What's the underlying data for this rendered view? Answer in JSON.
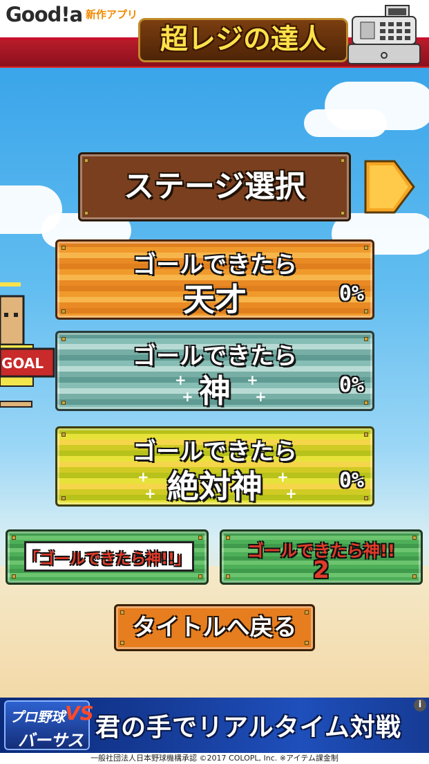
{
  "header": {
    "logo_text": "Good!a",
    "new_app_label": "新作アプリ",
    "app_title": "超レジの達人"
  },
  "menu": {
    "stage_select_label": "ステージ選択",
    "modes": [
      {
        "line1": "ゴールできたら",
        "line2": "天才",
        "progress": "0%"
      },
      {
        "line1": "ゴールできたら",
        "line2": "神",
        "progress": "0%"
      },
      {
        "line1": "ゴールできたら",
        "line2": "絶対神",
        "progress": "0%"
      }
    ],
    "game_links": [
      {
        "label": "「ゴールできたら神!!」"
      },
      {
        "label": "ゴールできたら神!!",
        "number": "2"
      }
    ],
    "back_label": "タイトルへ戻る"
  },
  "character": {
    "sign_text": "GOAL"
  },
  "ad": {
    "logo_line1": "プロ野球",
    "logo_vs": "VS",
    "logo_line2": "バーサス",
    "headline": "君の手でリアルタイム対戦",
    "info_icon": "i",
    "credit": "一般社団法人日本野球機構承認 ©2017 COLOPL, Inc. ※アイテム課金制"
  },
  "colors": {
    "sky": "#56b6ee",
    "header_red": "#b71c2a",
    "stage_brown": "#7a3f1e",
    "arrow_orange": "#f5a623"
  }
}
